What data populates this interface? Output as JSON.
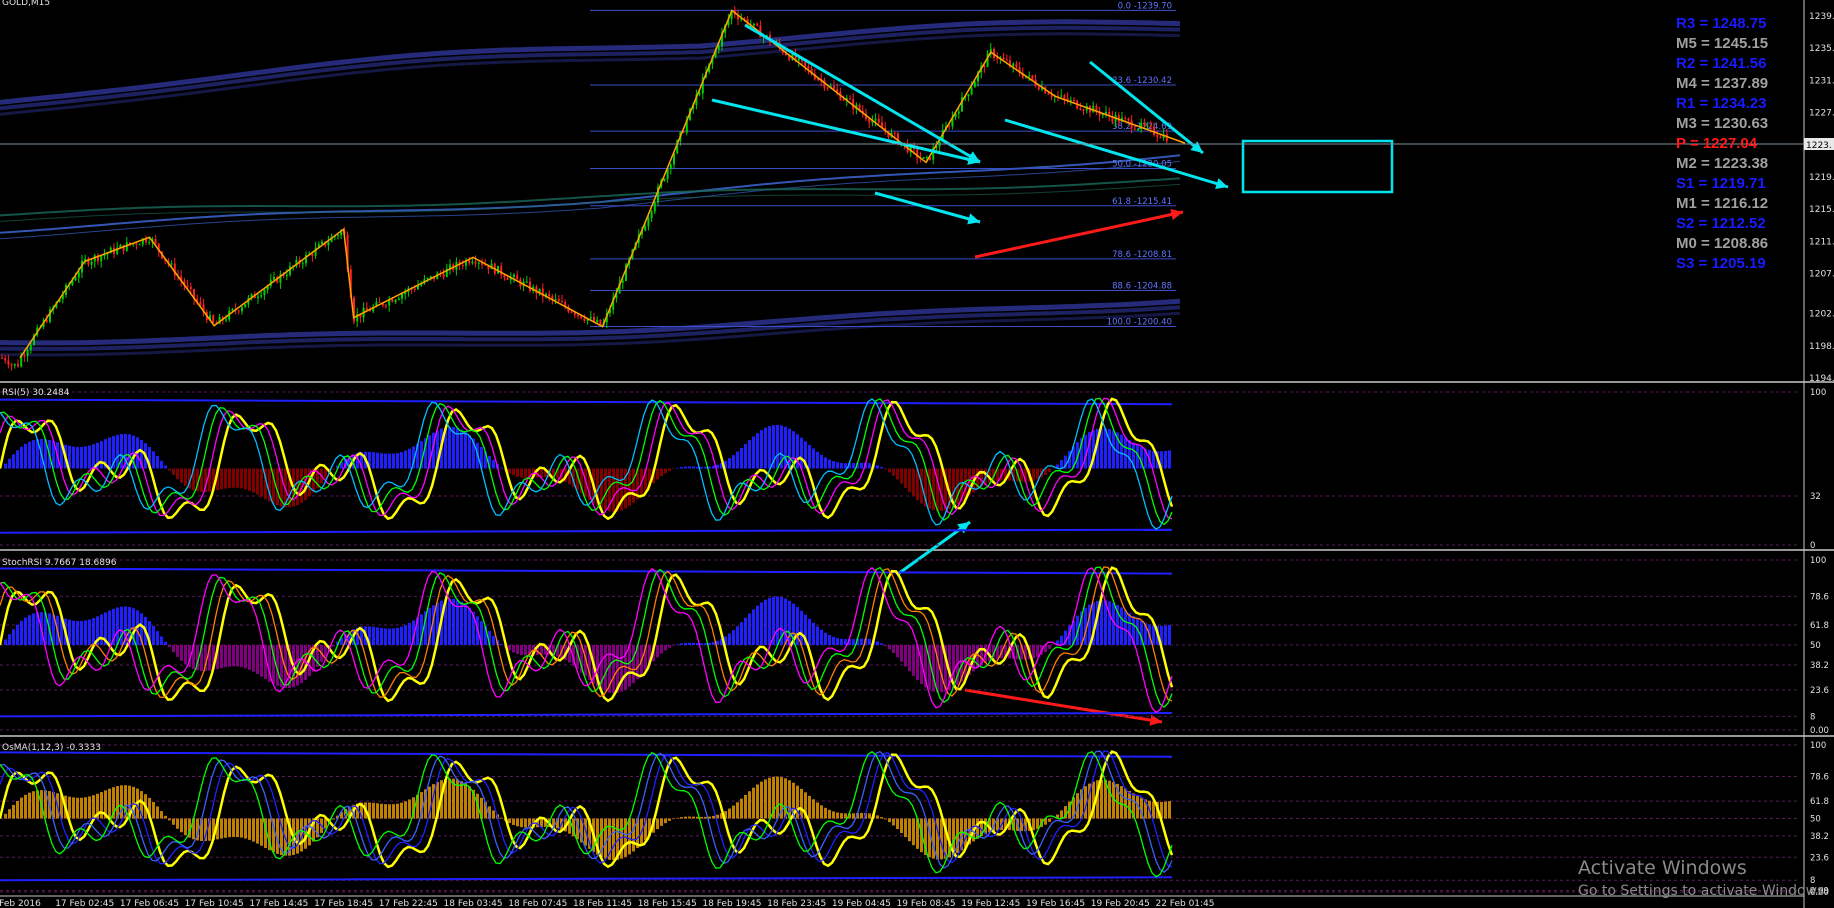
{
  "symbol_label": "GOLD,M15",
  "colors": {
    "background": "#000000",
    "bull": "#00d000",
    "bear": "#ff2020",
    "fib": "#3a4ec8",
    "zigzag": "#ffa500",
    "arrow_cyan": "#00e5ee",
    "arrow_red": "#ff1a1a",
    "osc_yellow": "#ffff00",
    "hist_blue": "#2020ff",
    "hist_red": "#800000",
    "hist_purple": "#800080",
    "pivot_r": "#1a1aff",
    "pivot_m": "#a0a0a0",
    "pivot_p": "#ff1a1a"
  },
  "price_axis": [
    "1239.",
    "1235.",
    "1231.",
    "1227.",
    "1223.",
    "1219.",
    "1215.",
    "1211.",
    "1207.",
    "1202.",
    "1198.",
    "1194."
  ],
  "current_price_tag": "1223.",
  "fib_levels": [
    {
      "label": "0.0 -1239.70",
      "value": 1239.7
    },
    {
      "label": "23.6 -1230.42",
      "value": 1230.42
    },
    {
      "label": "38.2 -1224.69",
      "value": 1224.69
    },
    {
      "label": "50.0 -1220.05",
      "value": 1220.05
    },
    {
      "label": "61.8 -1215.41",
      "value": 1215.41
    },
    {
      "label": "78.6 -1208.81",
      "value": 1208.81
    },
    {
      "label": "88.6 -1204.88",
      "value": 1204.88
    },
    {
      "label": "100.0 -1200.40",
      "value": 1200.4
    }
  ],
  "pivots": [
    {
      "label": "R3 = 1248.75",
      "kind": "r"
    },
    {
      "label": "M5 = 1245.15",
      "kind": "m"
    },
    {
      "label": "R2 = 1241.56",
      "kind": "r"
    },
    {
      "label": "M4 = 1237.89",
      "kind": "m"
    },
    {
      "label": "R1 = 1234.23",
      "kind": "r"
    },
    {
      "label": "M3 = 1230.63",
      "kind": "m"
    },
    {
      "label": "P  = 1227.04",
      "kind": "p"
    },
    {
      "label": "M2 = 1223.38",
      "kind": "m"
    },
    {
      "label": "S1 = 1219.71",
      "kind": "r"
    },
    {
      "label": "M1 = 1216.12",
      "kind": "m"
    },
    {
      "label": "S2 = 1212.52",
      "kind": "r"
    },
    {
      "label": "M0 = 1208.86",
      "kind": "m"
    },
    {
      "label": "S3 = 1205.19",
      "kind": "r"
    }
  ],
  "indicators": {
    "rsi": {
      "label": "RSI(5) 30.2484",
      "levels": [
        "100",
        "32",
        "0"
      ]
    },
    "stoch_rsi": {
      "label": "StochRSI 9.7667 18.6896",
      "levels": [
        "100",
        "78.6",
        "61.8",
        "50",
        "38.2",
        "23.6",
        "8",
        "0.00"
      ]
    },
    "osma": {
      "label": "OsMA(1,12,3) -0.3333",
      "levels": [
        "100",
        "78.6",
        "61.8",
        "50",
        "0.00",
        "38.2",
        "23.6",
        "8",
        "0.99"
      ]
    }
  },
  "time_axis": [
    "Feb 2016",
    "17 Feb 02:45",
    "17 Feb 06:45",
    "17 Feb 10:45",
    "17 Feb 14:45",
    "17 Feb 18:45",
    "17 Feb 22:45",
    "18 Feb 03:45",
    "18 Feb 07:45",
    "18 Feb 11:45",
    "18 Feb 15:45",
    "18 Feb 19:45",
    "18 Feb 23:45",
    "19 Feb 04:45",
    "19 Feb 08:45",
    "19 Feb 12:45",
    "19 Feb 16:45",
    "19 Feb 20:45",
    "22 Feb 01:45"
  ],
  "watermark": {
    "line1": "Activate Windows",
    "line2": "Go to Settings to activate Windows."
  },
  "chart_data": {
    "type": "candlestick",
    "symbol": "GOLD",
    "timeframe": "M15",
    "ylim": [
      1194,
      1240
    ],
    "zigzag_points": [
      {
        "time": "Feb 2016",
        "price": 1196.5
      },
      {
        "time": "17 Feb 02:45",
        "price": 1208.5
      },
      {
        "time": "17 Feb 06:45",
        "price": 1211.5
      },
      {
        "time": "17 Feb 10:45",
        "price": 1200.5
      },
      {
        "time": "17 Feb 18:45",
        "price": 1212.5
      },
      {
        "time": "17 Feb 18:45",
        "price": 1201.5
      },
      {
        "time": "18 Feb 03:45",
        "price": 1209.0
      },
      {
        "time": "18 Feb 11:45",
        "price": 1200.4
      },
      {
        "time": "18 Feb 19:45",
        "price": 1239.7
      },
      {
        "time": "19 Feb 08:45",
        "price": 1220.8
      },
      {
        "time": "19 Feb 12:45",
        "price": 1234.5
      },
      {
        "time": "19 Feb 16:45",
        "price": 1229.0
      },
      {
        "time": "22 Feb 01:45",
        "price": 1223.2
      }
    ],
    "close": 1223.2,
    "fib_retracement": {
      "from": 1200.4,
      "to": 1239.7
    }
  }
}
